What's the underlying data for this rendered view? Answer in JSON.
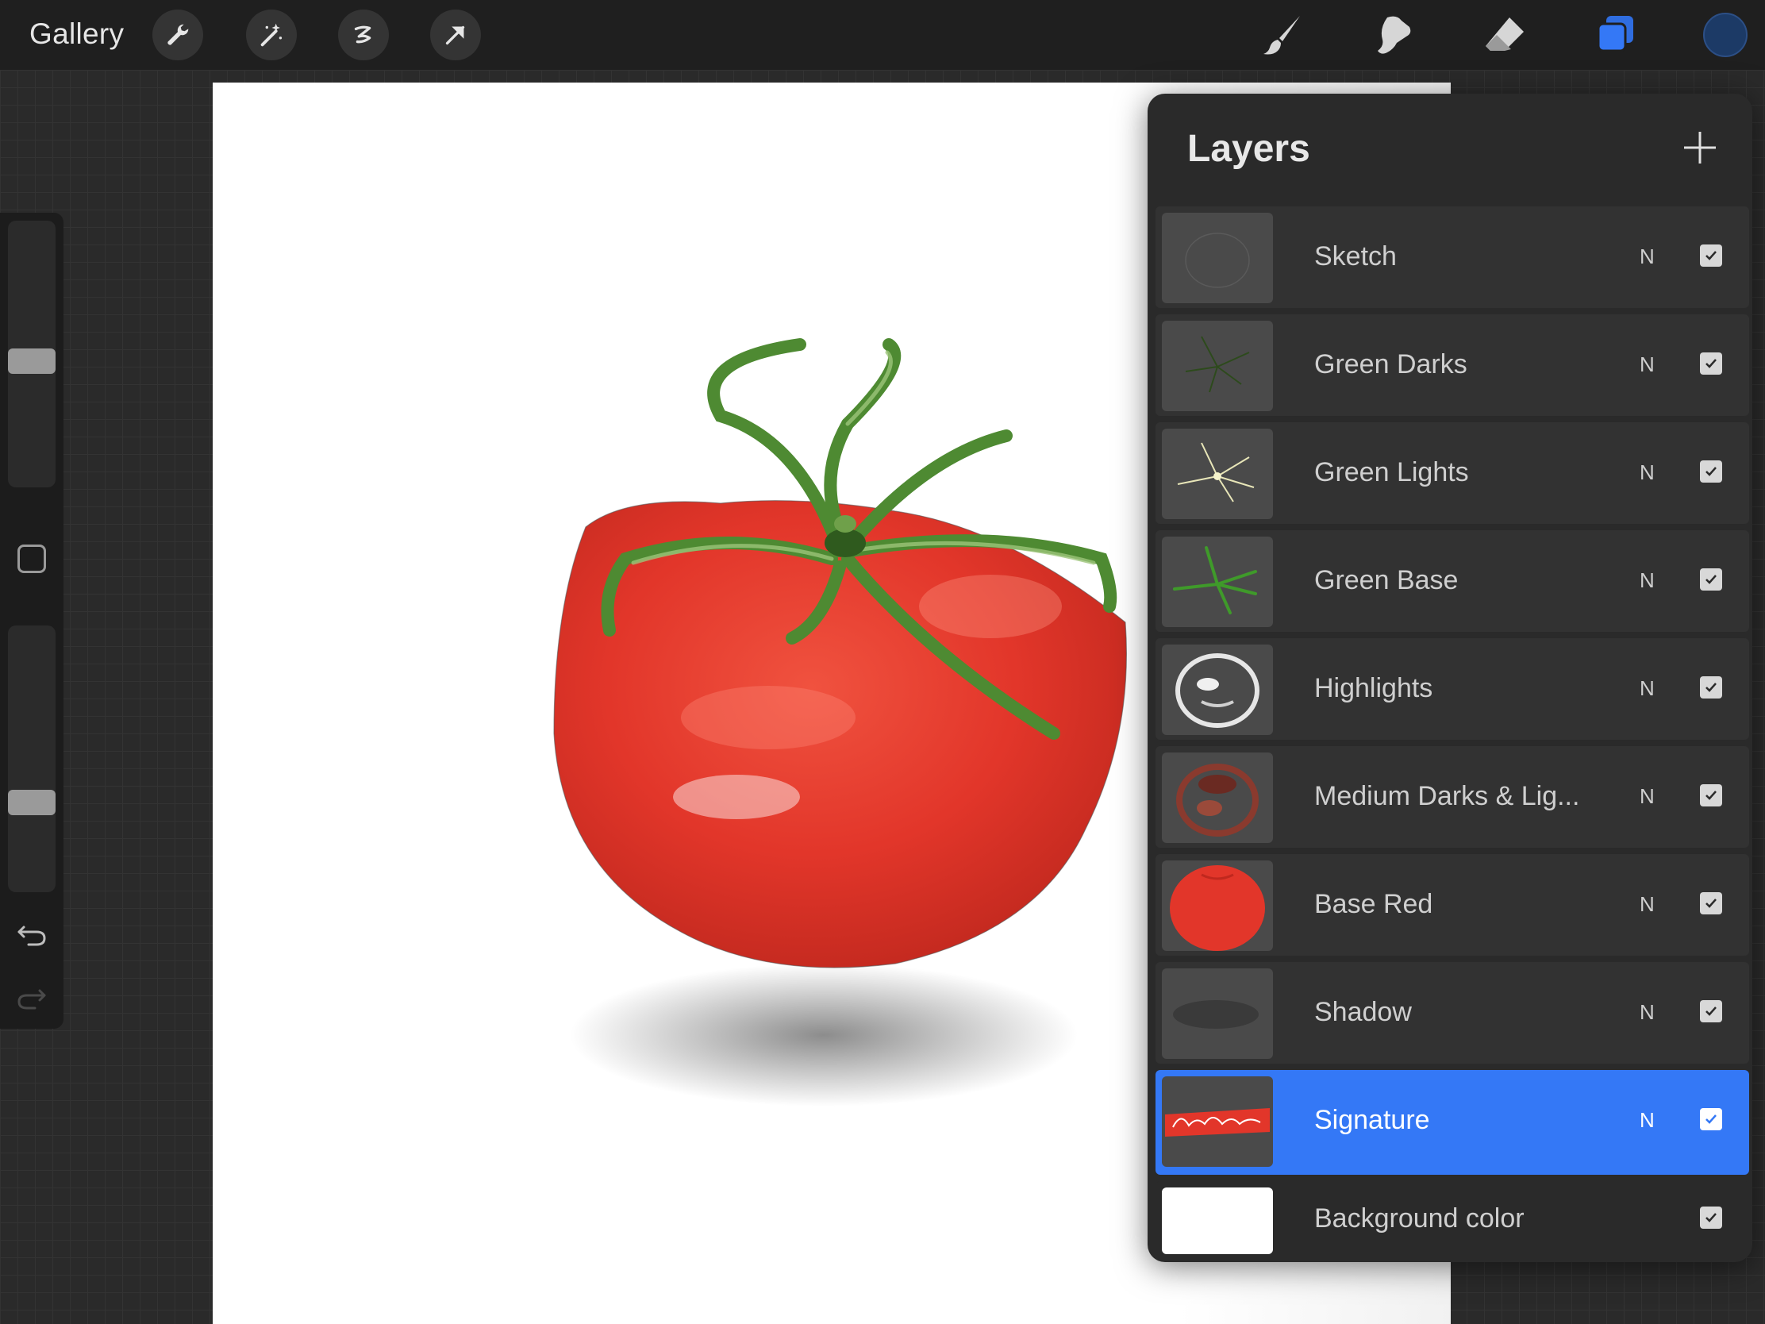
{
  "topbar": {
    "gallery_label": "Gallery",
    "tools": [
      {
        "icon": "wrench-icon",
        "label": "Actions"
      },
      {
        "icon": "magic-wand-icon",
        "label": "Adjustments"
      },
      {
        "icon": "selection-icon",
        "label": "Selection"
      },
      {
        "icon": "transform-arrow-icon",
        "label": "Transform"
      }
    ],
    "right_tools": [
      {
        "icon": "brush-icon"
      },
      {
        "icon": "smudge-icon"
      },
      {
        "icon": "eraser-icon"
      },
      {
        "icon": "layers-icon",
        "active": true
      }
    ],
    "current_color": "#1c3a66"
  },
  "sidebar": {
    "brush_size_level": 0.47,
    "opacity_level": 0.32,
    "undo_icon": "undo-icon",
    "redo_icon": "redo-icon"
  },
  "layers_panel": {
    "title": "Layers",
    "add_icon": "plus-icon",
    "layers": [
      {
        "name": "Sketch",
        "blend": "N",
        "visible": true,
        "selected": false
      },
      {
        "name": "Green Darks",
        "blend": "N",
        "visible": true,
        "selected": false
      },
      {
        "name": "Green Lights",
        "blend": "N",
        "visible": true,
        "selected": false
      },
      {
        "name": "Green Base",
        "blend": "N",
        "visible": true,
        "selected": false
      },
      {
        "name": "Highlights",
        "blend": "N",
        "visible": true,
        "selected": false
      },
      {
        "name": "Medium Darks & Lig...",
        "blend": "N",
        "visible": true,
        "selected": false
      },
      {
        "name": "Base Red",
        "blend": "N",
        "visible": true,
        "selected": false
      },
      {
        "name": "Shadow",
        "blend": "N",
        "visible": true,
        "selected": false
      },
      {
        "name": "Signature",
        "blend": "N",
        "visible": true,
        "selected": true
      }
    ],
    "background_layer": {
      "name": "Background color",
      "visible": true
    }
  },
  "colors": {
    "accent": "#3478f6",
    "tomato_red": "#e2362a",
    "stem_green": "#4e8a32"
  }
}
